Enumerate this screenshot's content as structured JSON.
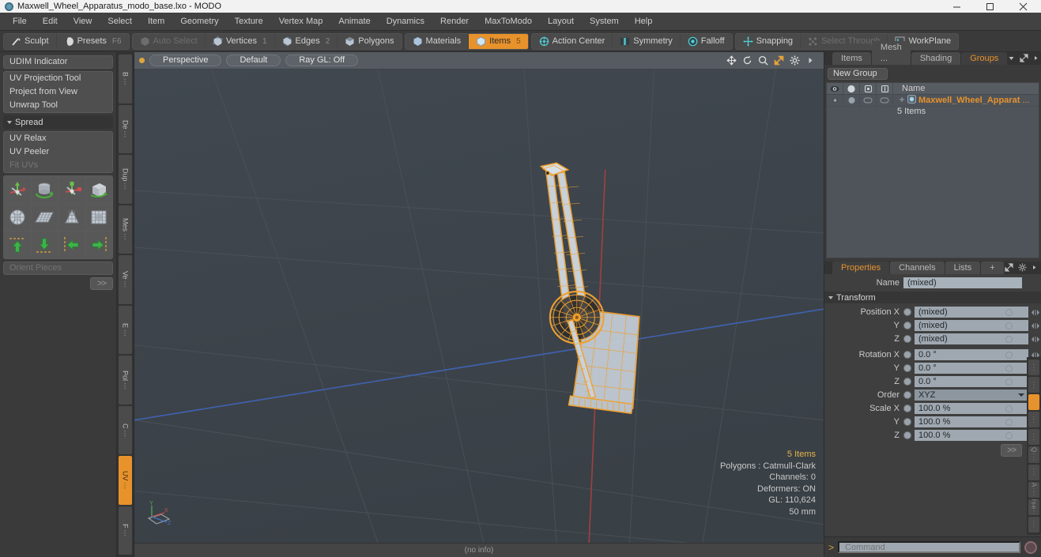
{
  "window": {
    "title": "Maxwell_Wheel_Apparatus_modo_base.lxo - MODO",
    "app_icon": "modo-sphere-icon",
    "controls": {
      "minimize": "minimize-icon",
      "maximize": "maximize-icon",
      "close": "close-icon"
    }
  },
  "menubar": {
    "items": [
      "File",
      "Edit",
      "View",
      "Select",
      "Item",
      "Geometry",
      "Texture",
      "Vertex Map",
      "Animate",
      "Dynamics",
      "Render",
      "MaxToModo",
      "Layout",
      "System",
      "Help"
    ]
  },
  "toolbar": {
    "groups": [
      {
        "buttons": [
          {
            "label": "Sculpt",
            "icon": "sculpt-brush-icon",
            "state": "normal",
            "count": ""
          },
          {
            "label": "Presets",
            "icon": "presets-sphere-icon",
            "state": "normal",
            "count": "F6"
          }
        ]
      },
      {
        "buttons": [
          {
            "label": "Auto Select",
            "icon": "auto-select-icon",
            "state": "disabled",
            "count": ""
          },
          {
            "label": "Vertices",
            "icon": "vertices-icon",
            "state": "normal",
            "count": "1"
          },
          {
            "label": "Edges",
            "icon": "edges-icon",
            "state": "normal",
            "count": "2"
          },
          {
            "label": "Polygons",
            "icon": "polygons-icon",
            "state": "normal",
            "count": ""
          }
        ]
      },
      {
        "buttons": [
          {
            "label": "Materials",
            "icon": "materials-icon",
            "state": "normal",
            "count": ""
          },
          {
            "label": "Items",
            "icon": "items-icon",
            "state": "active",
            "count": "5"
          }
        ]
      },
      {
        "buttons": [
          {
            "label": "Action Center",
            "icon": "action-center-icon",
            "state": "normal",
            "count": ""
          },
          {
            "label": "Symmetry",
            "icon": "symmetry-icon",
            "state": "normal",
            "count": ""
          },
          {
            "label": "Falloff",
            "icon": "falloff-icon",
            "state": "normal",
            "count": ""
          }
        ]
      },
      {
        "buttons": [
          {
            "label": "Snapping",
            "icon": "snapping-icon",
            "state": "normal",
            "count": ""
          },
          {
            "label": "Select Through",
            "icon": "select-through-icon",
            "state": "disabled",
            "count": ""
          },
          {
            "label": "WorkPlane",
            "icon": "workplane-icon",
            "state": "normal",
            "count": ""
          }
        ]
      }
    ]
  },
  "left_panel": {
    "udim_indicator": "UDIM Indicator",
    "projection_tools": [
      "UV Projection Tool",
      "Project from View",
      "Unwrap Tool"
    ],
    "spread_header": "Spread",
    "relax_tools": [
      {
        "label": "UV Relax",
        "disabled": false
      },
      {
        "label": "UV Peeler",
        "disabled": false
      },
      {
        "label": "Fit UVs",
        "disabled": true
      }
    ],
    "icon_rows": [
      [
        "uv-move-gizmo-icon",
        "uv-rotate-cylinder-icon",
        "uv-scale-gizmo-icon",
        "uv-unwrap-box-icon"
      ],
      [
        "uv-sphere-mesh-icon",
        "uv-grid-plane-icon",
        "uv-cone-mesh-icon",
        "uv-cube-unwrap-icon"
      ],
      [
        "align-up-icon",
        "align-down-icon",
        "align-left-icon",
        "align-right-icon"
      ]
    ],
    "orient_pieces": "Orient Pieces",
    "more_button": ">>",
    "vertical_tabs": [
      {
        "label": "B",
        "selected": false
      },
      {
        "label": "De",
        "selected": false
      },
      {
        "label": "Dup",
        "selected": false
      },
      {
        "label": "Mes",
        "selected": false
      },
      {
        "label": "Ve",
        "selected": false
      },
      {
        "label": "E",
        "selected": false
      },
      {
        "label": "Pol",
        "selected": false
      },
      {
        "label": "C",
        "selected": false
      },
      {
        "label": "UV",
        "selected": true
      },
      {
        "label": "F",
        "selected": false
      }
    ]
  },
  "viewport": {
    "header": {
      "view_mode": "Perspective",
      "shading": "Default",
      "raygl": "Ray GL: Off",
      "icons": [
        "move-view-icon",
        "rotate-view-icon",
        "zoom-view-icon",
        "fit-view-icon",
        "gear-icon",
        "chevron-right-icon"
      ]
    },
    "stats": {
      "items": "5 Items",
      "polygons": "Polygons : Catmull-Clark",
      "channels": "Channels: 0",
      "deformers": "Deformers: ON",
      "gl": "GL: 110,624",
      "scale": "50 mm"
    },
    "axis_gizmo": {
      "x": "X",
      "y": "Y",
      "z": "Z"
    },
    "footer": "(no info)",
    "model_name": "maxwell-wheel-apparatus-wireframe",
    "colors": {
      "background": "#3d4348",
      "wireframe": "#f0a02e",
      "surface": "#c9d2da",
      "x_axis": "#b04a4a",
      "z_axis": "#3c5ea8"
    }
  },
  "right_panel": {
    "top_tabs": [
      {
        "label": "Items",
        "selected": false
      },
      {
        "label": "Mesh ...",
        "selected": false
      },
      {
        "label": "Shading",
        "selected": false
      },
      {
        "label": "Groups",
        "selected": true
      }
    ],
    "top_tab_icons": [
      "chevron-down-icon",
      "expand-icon",
      "chevron-right-icon"
    ],
    "new_group_button": "New Group",
    "list_columns": [
      "eye-icon",
      "render-icon",
      "lock-icon",
      "selectable-icon"
    ],
    "list_name_header": "Name",
    "rows": [
      {
        "name": "Maxwell_Wheel_Apparat",
        "ellipsis": "...",
        "sub": "5 Items",
        "icon": "group-item-icon"
      }
    ],
    "prop_tabs": [
      {
        "label": "Properties",
        "selected": true
      },
      {
        "label": "Channels",
        "selected": false
      },
      {
        "label": "Lists",
        "selected": false
      },
      {
        "label": "+",
        "selected": false
      }
    ],
    "prop_tab_icons": [
      "expand-icon",
      "gear-icon",
      "chevron-right-icon"
    ],
    "name_label": "Name",
    "name_value": "(mixed)",
    "transform_header": "Transform",
    "transform_rows": [
      {
        "label": "Position X",
        "value": "(mixed)",
        "type": "field"
      },
      {
        "label": "Y",
        "value": "(mixed)",
        "type": "field"
      },
      {
        "label": "Z",
        "value": "(mixed)",
        "type": "field"
      },
      {
        "label": "Rotation X",
        "value": "0.0 °",
        "type": "field"
      },
      {
        "label": "Y",
        "value": "0.0 °",
        "type": "field"
      },
      {
        "label": "Z",
        "value": "0.0 °",
        "type": "field"
      },
      {
        "label": "Order",
        "value": "XYZ",
        "type": "dropdown"
      },
      {
        "label": "Scale X",
        "value": "100.0 %",
        "type": "field"
      },
      {
        "label": "Y",
        "value": "100.0 %",
        "type": "field"
      },
      {
        "label": "Z",
        "value": "100.0 %",
        "type": "field"
      }
    ],
    "more_button": ">>",
    "vertical_tabs": [
      {
        "label": "",
        "selected": false
      },
      {
        "label": "",
        "selected": false
      },
      {
        "label": "",
        "selected": true
      },
      {
        "label": "",
        "selected": false
      },
      {
        "label": "",
        "selected": false
      },
      {
        "label": "Q",
        "selected": false
      },
      {
        "label": "",
        "selected": false
      },
      {
        "label": "A",
        "selected": false
      },
      {
        "label": "Use",
        "selected": false
      },
      {
        "label": "",
        "selected": false
      }
    ]
  },
  "command_bar": {
    "prompt": ">",
    "placeholder": "Command",
    "value": "Command",
    "record_icon": "record-circle-icon"
  }
}
